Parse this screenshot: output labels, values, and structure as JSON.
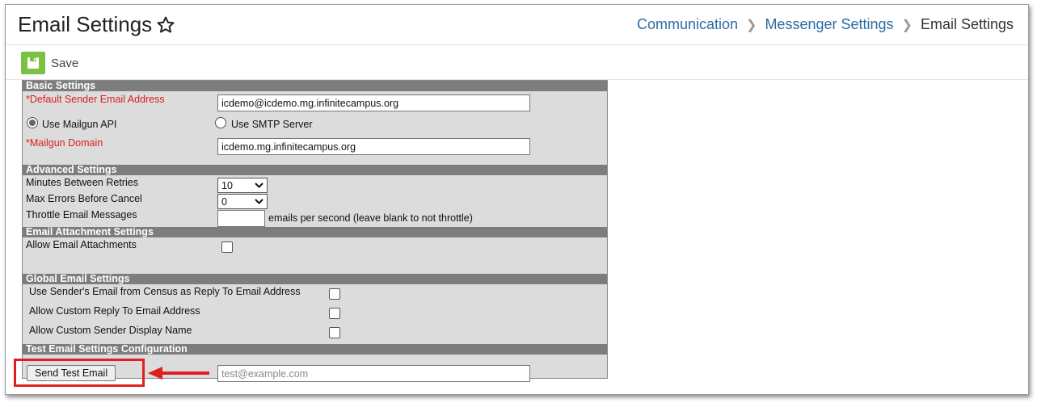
{
  "header": {
    "title": "Email Settings",
    "favorite_icon": "star-outline-icon",
    "breadcrumbs": [
      "Communication",
      "Messenger Settings",
      "Email Settings"
    ]
  },
  "toolbar": {
    "save_label": "Save",
    "save_icon": "save-icon",
    "accent": "#7cc242"
  },
  "basic": {
    "heading": "Basic Settings",
    "sender_label": "*Default Sender Email Address",
    "sender_value": "icdemo@icdemo.mg.infinitecampus.org",
    "mailgun_api_label": "Use Mailgun API",
    "smtp_label": "Use SMTP Server",
    "selected_option": "Use Mailgun API",
    "domain_label": "*Mailgun Domain",
    "domain_value": "icdemo.mg.infinitecampus.org"
  },
  "advanced": {
    "heading": "Advanced Settings",
    "retries_label": "Minutes Between Retries",
    "retries_value": "10",
    "errors_label": "Max Errors Before Cancel",
    "errors_value": "0",
    "throttle_label": "Throttle Email Messages",
    "throttle_value": "",
    "throttle_hint": "emails per second (leave blank to not throttle)"
  },
  "attachments": {
    "heading": "Email Attachment Settings",
    "allow_label": "Allow Email Attachments",
    "allow_checked": false
  },
  "global": {
    "heading": "Global Email Settings",
    "census_reply_label": "Use Sender's Email from Census as Reply To Email Address",
    "custom_reply_label": "Allow Custom Reply To Email Address",
    "custom_display_label": "Allow Custom Sender Display Name"
  },
  "test": {
    "heading": "Test Email Settings Configuration",
    "button_label": "Send Test Email",
    "email_placeholder": "test@example.com",
    "highlight_color": "#e02020"
  }
}
